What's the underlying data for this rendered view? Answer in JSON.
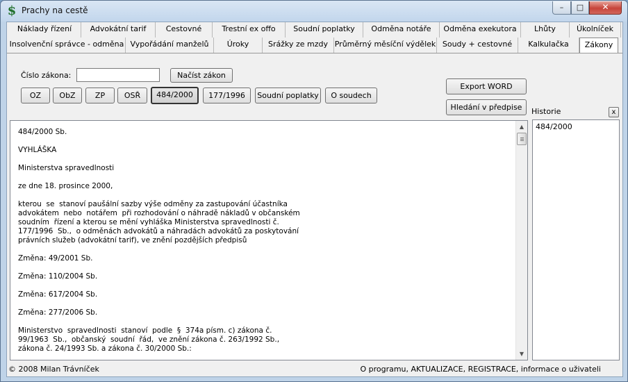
{
  "window": {
    "title": "Prachy na cestě",
    "app_icon": "$",
    "close_glyph": "✕",
    "max_glyph": "□",
    "min_glyph": "–"
  },
  "tabs_row1": [
    "Náklady řízení",
    "Advokátní tarif",
    "Cestovné",
    "Trestní ex offo",
    "Soudní poplatky",
    "Odměna notáře",
    "Odměna exekutora",
    "Lhůty",
    "Úkolníček"
  ],
  "tabs_row2": [
    "Insolvenční správce - odměna",
    "Vypořádání manželů",
    "Úroky",
    "Srážky ze mzdy",
    "Průměrný měsíční výdělek",
    "Soudy + cestovné",
    "Kalkulačka",
    "Zákony"
  ],
  "active_tab": "Zákony",
  "law_lookup": {
    "label": "Číslo zákona:",
    "value": "",
    "load_button": "Načíst zákon"
  },
  "quick_buttons": [
    "OZ",
    "ObZ",
    "ZP",
    "OSŘ",
    "484/2000",
    "177/1996",
    "Soudní poplatky",
    "O soudech"
  ],
  "pressed_button": "484/2000",
  "actions": {
    "export": "Export WORD",
    "search": "Hledání v předpise"
  },
  "history": {
    "label": "Historie",
    "close": "x",
    "items": [
      "484/2000"
    ]
  },
  "document_text": "484/2000 Sb.\n\nVYHLÁŠKA\n\nMinisterstva spravedlnosti\n\nze dne 18. prosince 2000,\n\nkterou  se  stanoví paušální sazby výše odměny za zastupování účastníka\nadvokátem  nebo  notářem  při rozhodování o náhradě nákladů v občanském\nsoudním  řízení a kterou se mění vyhláška Ministerstva spravedlnosti č.\n177/1996  Sb.,  o odměnách advokátů a náhradách advokátů za poskytování\nprávních služeb (advokátní tarif), ve znění pozdějších předpisů\n\nZměna: 49/2001 Sb.\n\nZměna: 110/2004 Sb.\n\nZměna: 617/2004 Sb.\n\nZměna: 277/2006 Sb.\n\nMinisterstvo  spravedlnosti  stanoví  podle  §  374a písm. c) zákona č.\n99/1963  Sb.,  občanský  soudní  řád,  ve znění zákona č. 263/1992 Sb.,\nzákona č. 24/1993 Sb. a zákona č. 30/2000 Sb.:",
  "status": {
    "left": "© 2008 Milan Trávníček",
    "right": "O programu, AKTUALIZACE, REGISTRACE, informace o uživateli"
  }
}
